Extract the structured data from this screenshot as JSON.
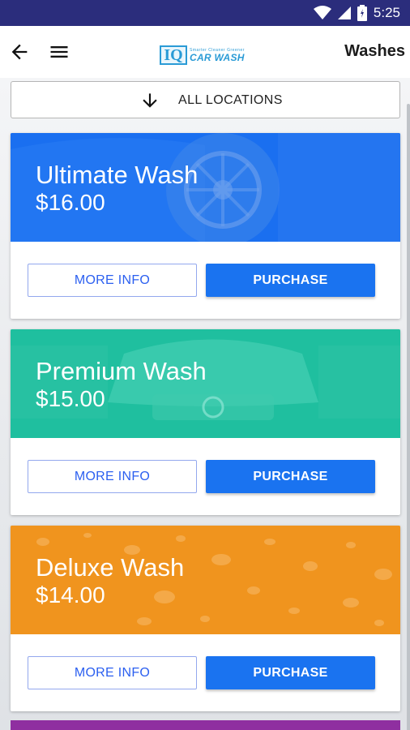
{
  "status_bar": {
    "time": "5:25",
    "icons": [
      "wifi-icon",
      "cell-signal-icon",
      "battery-icon"
    ]
  },
  "app_bar": {
    "title": "Washes",
    "back_icon": "arrow-left-icon",
    "menu_icon": "hamburger-menu-icon",
    "logo": {
      "mark": "IQ",
      "tagline": "Smarter Cleaner Greener",
      "name": "CAR WASH"
    }
  },
  "location_filter": {
    "icon": "arrow-down-icon",
    "label": "ALL LOCATIONS"
  },
  "washes": [
    {
      "name": "Ultimate Wash",
      "price": "$16.00",
      "color": "#1a6ff0",
      "more_info_label": "MORE INFO",
      "purchase_label": "PURCHASE"
    },
    {
      "name": "Premium Wash",
      "price": "$15.00",
      "color": "#1fbf9f",
      "more_info_label": "MORE INFO",
      "purchase_label": "PURCHASE"
    },
    {
      "name": "Deluxe Wash",
      "price": "$14.00",
      "color": "#f0941e",
      "more_info_label": "MORE INFO",
      "purchase_label": "PURCHASE"
    }
  ],
  "colors": {
    "status_bar": "#2b2d7c",
    "primary_button": "#1a73f0",
    "peek_card": "#8f2fa0"
  }
}
